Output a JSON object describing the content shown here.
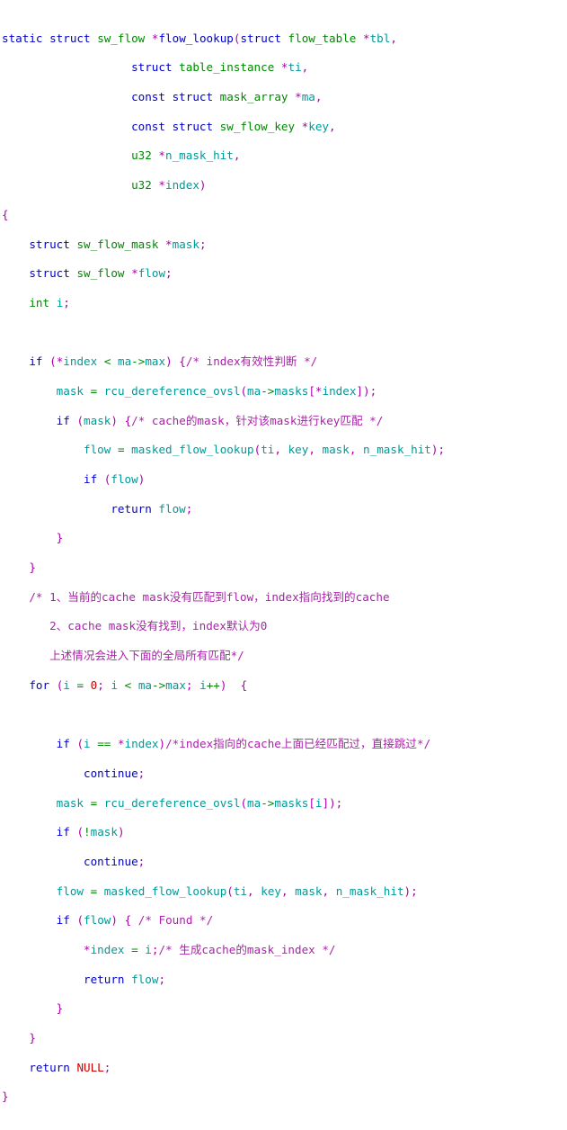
{
  "editor": {
    "language": "c",
    "background": "#ffffff",
    "font_size_px": 12.6,
    "line_height_px": 16.35
  },
  "palette": {
    "keyword": "#0000cc",
    "type": "#008800",
    "identifier": "#009999",
    "function": "#0000cc",
    "punctuation": "#aa00aa",
    "operator": "#008800",
    "number": "#cc0000",
    "constant": "#cc0000",
    "comment": "#aa22aa",
    "plain": "#000000"
  },
  "code": {
    "title": "flow_lookup",
    "lines": [
      "static struct sw_flow *flow_lookup(struct flow_table *tbl,",
      "                   struct table_instance *ti,",
      "                   const struct mask_array *ma,",
      "                   const struct sw_flow_key *key,",
      "                   u32 *n_mask_hit,",
      "                   u32 *index)",
      "{",
      "    struct sw_flow_mask *mask;",
      "    struct sw_flow *flow;",
      "    int i;",
      "",
      "    if (*index < ma->max) {/* index有效性判断 */",
      "        mask = rcu_dereference_ovsl(ma->masks[*index]);",
      "        if (mask) {/* cache的mask，针对该mask进行key匹配 */",
      "            flow = masked_flow_lookup(ti, key, mask, n_mask_hit);",
      "            if (flow)",
      "                return flow;",
      "        }",
      "    }",
      "    /* 1、当前的cache mask没有匹配到flow，index指向找到的cache",
      "       2、cache mask没有找到，index默认为0",
      "       上述情况会进入下面的全局所有匹配*/",
      "    for (i = 0; i < ma->max; i++)  {",
      "",
      "        if (i == *index)/*index指向的cache上面已经匹配过，直接跳过*/",
      "            continue;",
      "        mask = rcu_dereference_ovsl(ma->masks[i]);",
      "        if (!mask)",
      "            continue;",
      "        flow = masked_flow_lookup(ti, key, mask, n_mask_hit);",
      "        if (flow) { /* Found */",
      "            *index = i;/* 生成cache的mask_index */",
      "            return flow;",
      "        }",
      "    }",
      "    return NULL;",
      "}"
    ],
    "comments": [
      "/* index有效性判断 */",
      "/* cache的mask，针对该mask进行key匹配 */",
      "/* 1、当前的cache mask没有匹配到flow，index指向找到的cache",
      "2、cache mask没有找到，index默认为0",
      "上述情况会进入下面的全局所有匹配*/",
      "/*index指向的cache上面已经匹配过，直接跳过*/",
      "/* Found */",
      "/* 生成cache的mask_index */"
    ],
    "identifiers": [
      "flow_lookup",
      "flow_table",
      "tbl",
      "table_instance",
      "ti",
      "mask_array",
      "ma",
      "sw_flow_key",
      "key",
      "n_mask_hit",
      "index",
      "sw_flow_mask",
      "mask",
      "sw_flow",
      "flow",
      "i",
      "max",
      "masks",
      "rcu_dereference_ovsl",
      "masked_flow_lookup",
      "NULL",
      "u32"
    ],
    "keywords": [
      "static",
      "struct",
      "const",
      "int",
      "if",
      "for",
      "return",
      "continue"
    ]
  }
}
